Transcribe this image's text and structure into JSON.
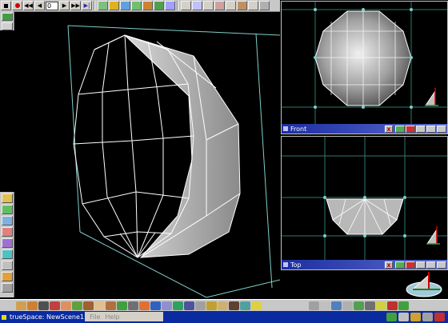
{
  "toolbar": {
    "frame_value": "0",
    "buttons": [
      "stop-button",
      "record-button",
      "rewind-button",
      "play-back-button",
      "frame-field",
      "play-button",
      "forward-button",
      "end-button"
    ]
  },
  "viewports": {
    "front": {
      "label": "Front"
    },
    "top": {
      "label": "Top"
    }
  },
  "taskbar": {
    "app_title": "trueSpace: NewScene1"
  },
  "menu": {
    "file": "File",
    "help": "Help"
  },
  "colors": {
    "background": "#000000",
    "toolbar": "#c8c8c8",
    "viewport_title": "#1c2ea0",
    "taskbar": "#0a2aa0",
    "wireframe": "#ffffff",
    "bounding_box": "#7fcfc8"
  }
}
